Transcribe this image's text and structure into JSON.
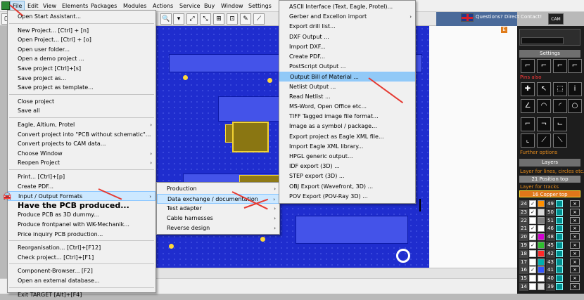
{
  "menubar": {
    "items": [
      "File",
      "Edit",
      "View",
      "Elements",
      "Packages",
      "Modules",
      "Actions",
      "Service",
      "Buy",
      "Window",
      "Settings"
    ]
  },
  "toolbar": {
    "help_text": "Questions? Direct Contact!",
    "cam_label": "CAM"
  },
  "canvas": {
    "marker_label": "E"
  },
  "file_menu": {
    "items": [
      {
        "label": "Open Start Assistant..."
      },
      {
        "label": "New Project...      [Ctrl] + [n]"
      },
      {
        "label": "Open Project...     [Ctrl] + [o]"
      },
      {
        "label": "Open user folder..."
      },
      {
        "label": "Open a demo project ..."
      },
      {
        "label": "Save project     [Ctrl]+[s]"
      },
      {
        "label": "Save project as..."
      },
      {
        "label": "Save project as template..."
      },
      {
        "label": "Close project"
      },
      {
        "label": "Save all"
      },
      {
        "label": "Eagle, Altium, Protel",
        "sub": true
      },
      {
        "label": "Convert project into \"PCB without schematic\"..."
      },
      {
        "label": "Convert projects to CAM data..."
      },
      {
        "label": "Choose Window",
        "sub": true
      },
      {
        "label": "Reopen Project",
        "sub": true
      },
      {
        "label": "Print...         [Ctrl]+[p]"
      },
      {
        "label": "Create PDF..."
      },
      {
        "label": "Input / Output Formats",
        "sub": true
      },
      {
        "label": "Have the PCB produced..."
      },
      {
        "label": "Produce PCB as 3D dummy..."
      },
      {
        "label": "Produce frontpanel with WK-Mechanik..."
      },
      {
        "label": "Price inquiry PCB production..."
      },
      {
        "label": "Reorganisation...       [Ctrl]+[F12]"
      },
      {
        "label": "Check project...        [Ctrl]+[F1]"
      },
      {
        "label": "Component-Browser...        [F2]"
      },
      {
        "label": "Open an external database..."
      },
      {
        "label": "Exit TARGET        [Alt]+[F4]"
      }
    ]
  },
  "io_menu": {
    "items": [
      {
        "label": "Production",
        "sub": true
      },
      {
        "label": "Data exchange / documentation",
        "sub": true
      },
      {
        "label": "Test adapter",
        "sub": true
      },
      {
        "label": "Cable harnesses",
        "sub": true
      },
      {
        "label": "Reverse design",
        "sub": true
      }
    ]
  },
  "data_menu": {
    "items": [
      {
        "label": "ASCII Interface (Text, Eagle, Protel)..."
      },
      {
        "label": "Gerber and Excellon import",
        "sub": true
      },
      {
        "label": "Export drill list..."
      },
      {
        "label": "DXF Output ..."
      },
      {
        "label": "Import DXF..."
      },
      {
        "label": "Create PDF..."
      },
      {
        "label": "PostScript Output ..."
      },
      {
        "label": "Output Bill of Material ..."
      },
      {
        "label": "Netlist Output ..."
      },
      {
        "label": "Read Netlist ..."
      },
      {
        "label": "MS-Word, Open Office etc..."
      },
      {
        "label": "TIFF Tagged image file format..."
      },
      {
        "label": "Image as a symbol / package..."
      },
      {
        "label": "Export project as Eagle XML file..."
      },
      {
        "label": "Import Eagle XML library..."
      },
      {
        "label": "HPGL generic output..."
      },
      {
        "label": "IDF export (3D) ..."
      },
      {
        "label": "STEP export (3D) ..."
      },
      {
        "label": "OBJ Export (Wavefront, 3D) ..."
      },
      {
        "label": "POV Export (POV-Ray 3D) ..."
      }
    ]
  },
  "sidebar": {
    "settings_title": "Settings",
    "pins_label": "Pins also",
    "further_options": "Further options",
    "layers_title": "Layers",
    "lines_label": "Layer for lines, circles etc...",
    "lines_value": "21 Position top",
    "tracks_label": "Layer for tracks",
    "tracks_value": "16 Copper top",
    "layers": [
      {
        "n": "24",
        "c": "✓",
        "color": "#ff8f00",
        "n2": "49"
      },
      {
        "n": "23",
        "c": "✓",
        "color": "#d8d8d8",
        "n2": "50"
      },
      {
        "n": "22",
        "c": "",
        "color": "#808080",
        "n2": "51"
      },
      {
        "n": "21",
        "c": "✓",
        "color": "#ffffff",
        "n2": "46"
      },
      {
        "n": "20",
        "c": "✓",
        "color": "#d100d1",
        "n2": "48"
      },
      {
        "n": "19",
        "c": "✓",
        "color": "#2fbf2f",
        "n2": "45"
      },
      {
        "n": "18",
        "c": "",
        "color": "#ff2a2a",
        "n2": "42"
      },
      {
        "n": "17",
        "c": "",
        "color": "#00b0b0",
        "n2": "43"
      },
      {
        "n": "16",
        "c": "✓",
        "color": "#3355ff",
        "n2": "41"
      },
      {
        "n": "15",
        "c": "",
        "color": "#ffffff",
        "n2": "40"
      },
      {
        "n": "14",
        "c": "",
        "color": "#e0e0e0",
        "n2": "39"
      }
    ]
  }
}
